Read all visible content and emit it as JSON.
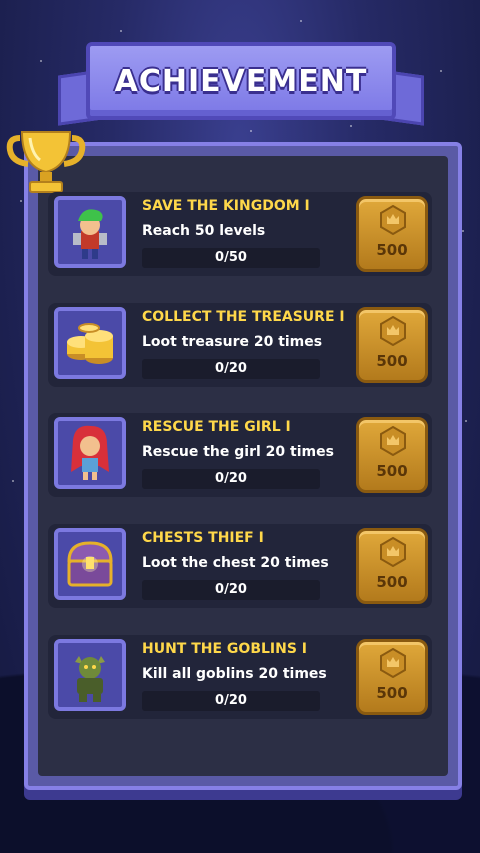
{
  "header": {
    "title": "ACHIEVEMENT"
  },
  "achievements": [
    {
      "title": "SAVE THE KINGDOM I",
      "description": "Reach 50 levels",
      "progress_text": "0/50",
      "progress": 0,
      "reward": "500",
      "icon": "hero-icon"
    },
    {
      "title": "COLLECT THE TREASURE I",
      "description": "Loot treasure 20 times",
      "progress_text": "0/20",
      "progress": 0,
      "reward": "500",
      "icon": "gold-coins-icon"
    },
    {
      "title": "RESCUE THE GIRL I",
      "description": "Rescue the girl 20 times",
      "progress_text": "0/20",
      "progress": 0,
      "reward": "500",
      "icon": "girl-icon"
    },
    {
      "title": "CHESTS THIEF I",
      "description": "Loot the chest 20 times",
      "progress_text": "0/20",
      "progress": 0,
      "reward": "500",
      "icon": "treasure-chest-icon"
    },
    {
      "title": "HUNT THE GOBLINS I",
      "description": "Kill all goblins 20 times",
      "progress_text": "0/20",
      "progress": 0,
      "reward": "500",
      "icon": "goblin-icon"
    }
  ],
  "colors": {
    "title_yellow": "#ffd84a",
    "panel_purple": "#8680e6",
    "reward_gold": "#e0a83a"
  }
}
